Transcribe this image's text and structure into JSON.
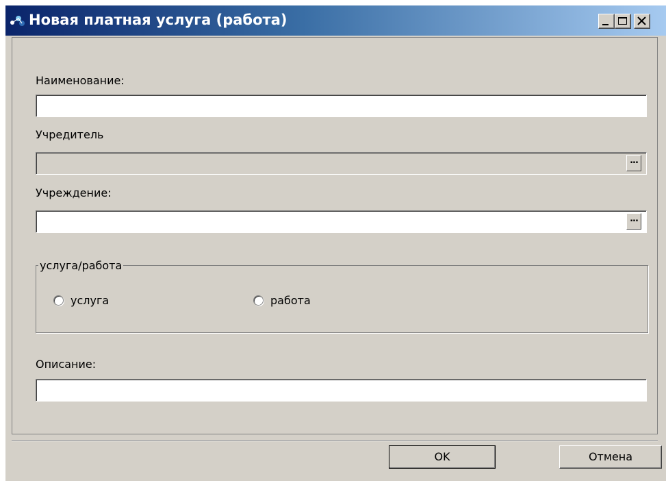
{
  "window": {
    "title": "Новая платная услуга (работа)",
    "controls": {
      "minimize": "minimize-icon",
      "maximize": "maximize-icon",
      "close": "close-icon"
    }
  },
  "form": {
    "name_label": "Наименование:",
    "name_value": "",
    "founder_label": "Учредитель",
    "founder_value": "",
    "founder_browse": "...",
    "institution_label": "Учреждение:",
    "institution_value": "",
    "institution_browse": "...",
    "type_group_title": "услуга/работа",
    "type_options": [
      "услуга",
      "работа"
    ],
    "description_label": "Описание:",
    "description_value": ""
  },
  "buttons": {
    "ok_label": "OK",
    "cancel_label": "Отмена"
  },
  "colors": {
    "window_bg": "#d4d0c8",
    "title_start": "#0a246a",
    "title_end": "#a6caf0"
  }
}
